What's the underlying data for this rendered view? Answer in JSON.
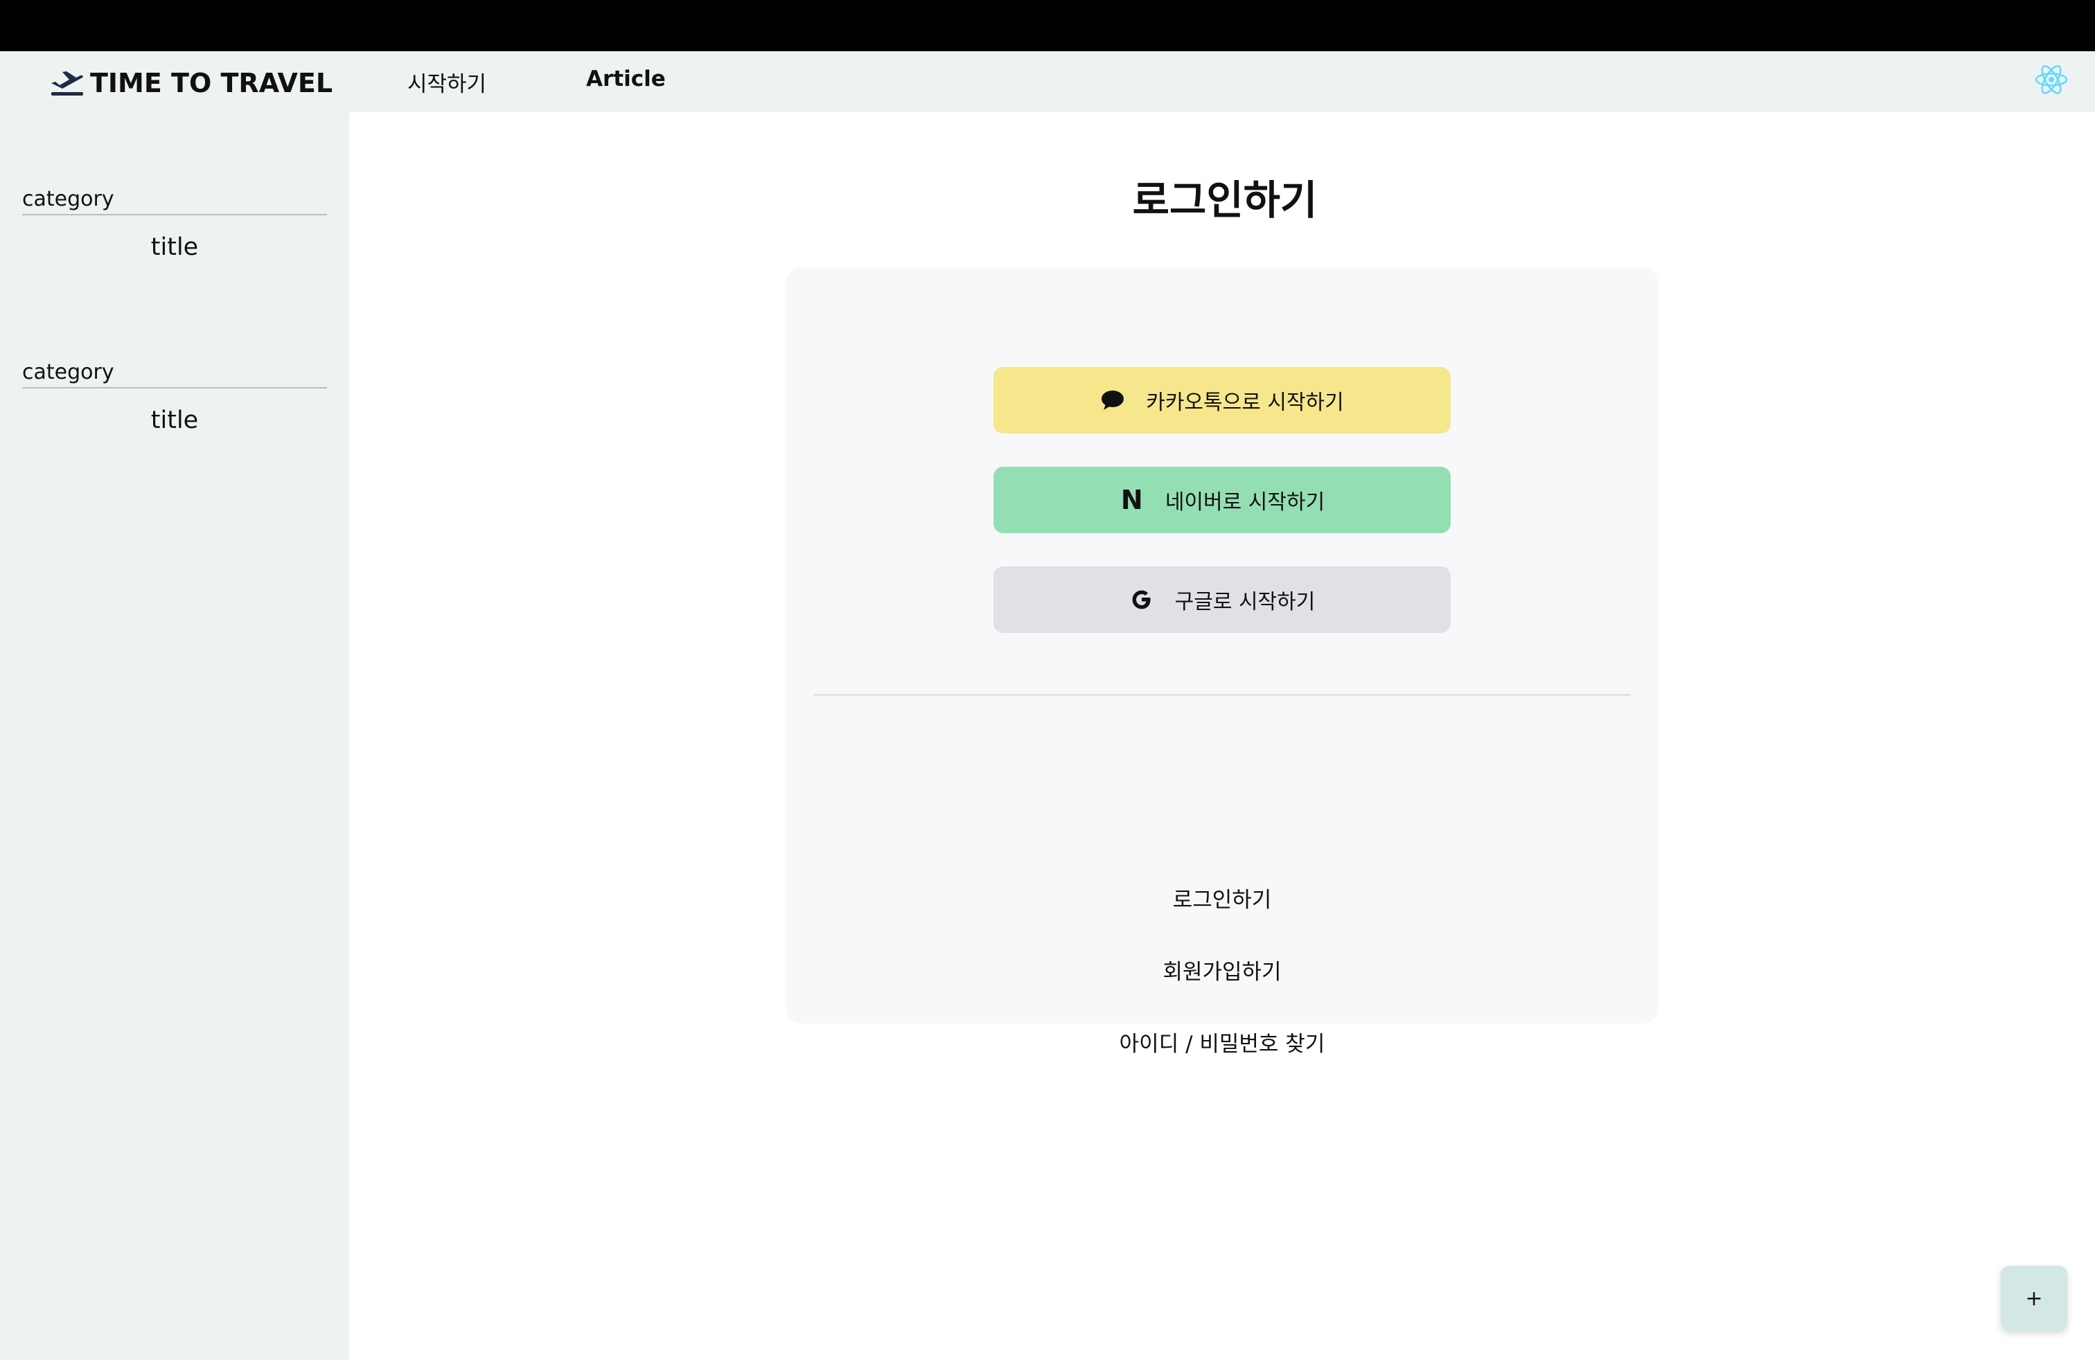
{
  "header": {
    "logo_text": "TIME TO TRAVEL",
    "nav": [
      {
        "label": "시작하기"
      },
      {
        "label": "Article"
      }
    ]
  },
  "sidebar": {
    "groups": [
      {
        "category": "category",
        "title": "title"
      },
      {
        "category": "category",
        "title": "title"
      }
    ]
  },
  "main": {
    "page_title": "로그인하기",
    "sso_buttons": [
      {
        "label": "카카오톡으로 시작하기",
        "icon": "chat-bubble-icon",
        "color": "#f6e68c"
      },
      {
        "label": "네이버로 시작하기",
        "icon": "naver-n-icon",
        "icon_text": "N",
        "color": "#94deb4"
      },
      {
        "label": "구글로 시작하기",
        "icon": "google-g-icon",
        "color": "#dfe1e6"
      }
    ],
    "links": [
      {
        "label": "로그인하기"
      },
      {
        "label": "회원가입하기"
      },
      {
        "label": "아이디 / 비밀번호 찾기"
      }
    ]
  },
  "fab": {
    "label": "+"
  },
  "colors": {
    "topstrip": "#000000",
    "sidebar_bg": "#eef2f1",
    "card_bg": "#f7f8f9",
    "fab_bg": "#d3e7e4",
    "react_accent": "#61dafb",
    "logo_navy": "#1d2a4a"
  }
}
